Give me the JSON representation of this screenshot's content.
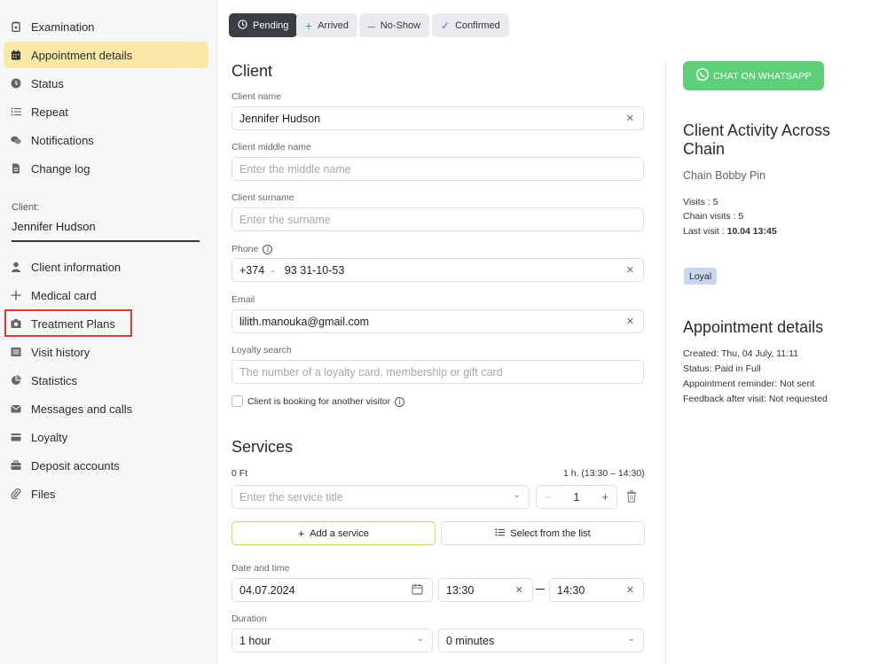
{
  "sidebar": {
    "top_items": [
      {
        "label": "Examination",
        "icon": "clipboard-icon"
      },
      {
        "label": "Appointment details",
        "icon": "calendar-icon"
      },
      {
        "label": "Status",
        "icon": "clock-icon"
      },
      {
        "label": "Repeat",
        "icon": "list-icon"
      },
      {
        "label": "Notifications",
        "icon": "chat-icon"
      },
      {
        "label": "Change log",
        "icon": "document-icon"
      }
    ],
    "client_label": "Client:",
    "client_name": "Jennifer Hudson",
    "client_items": [
      {
        "label": "Client information",
        "icon": "user-icon"
      },
      {
        "label": "Medical card",
        "icon": "plus-icon"
      },
      {
        "label": "Treatment Plans",
        "icon": "camera-icon"
      },
      {
        "label": "Visit history",
        "icon": "list-box-icon"
      },
      {
        "label": "Statistics",
        "icon": "pie-chart-icon"
      },
      {
        "label": "Messages and calls",
        "icon": "envelope-icon"
      },
      {
        "label": "Loyalty",
        "icon": "card-icon"
      },
      {
        "label": "Deposit accounts",
        "icon": "briefcase-icon"
      },
      {
        "label": "Files",
        "icon": "paperclip-icon"
      }
    ]
  },
  "status_chips": [
    {
      "label": "Pending",
      "icon": "clock-icon",
      "active": true
    },
    {
      "label": "Arrived",
      "icon": "plus-icon"
    },
    {
      "label": "No-Show",
      "icon": "minus-icon"
    },
    {
      "label": "Confirmed",
      "icon": "check-icon"
    }
  ],
  "client_section": {
    "title": "Client",
    "name_label": "Client name",
    "name_value": "Jennifer Hudson",
    "middle_label": "Client middle name",
    "middle_placeholder": "Enter the middle name",
    "surname_label": "Client surname",
    "surname_placeholder": "Enter the surname",
    "phone_label": "Phone",
    "phone_code": "+374",
    "phone_number": "93 31-10-53",
    "email_label": "Email",
    "email_value": "lilith.manouka@gmail.com",
    "loyalty_label": "Loyalty search",
    "loyalty_placeholder": "The number of a loyalty card, membership or gift card",
    "another_visitor_label": "Client is booking for another visitor"
  },
  "services_section": {
    "title": "Services",
    "price": "0 Ft",
    "duration_range": "1 h. (13:30 – 14:30)",
    "service_placeholder": "Enter the service title",
    "quantity": "1",
    "add_service_label": "Add a service",
    "select_list_label": "Select from the list",
    "date_time_label": "Date and time",
    "date_value": "04.07.2024",
    "start_time": "13:30",
    "end_time": "14:30",
    "duration_label": "Duration",
    "duration_hours": "1 hour",
    "duration_minutes": "0 minutes"
  },
  "right_panel": {
    "whatsapp_label": "CHAT ON WHATSAPP",
    "activity_title_line1": "Client Activity Across",
    "activity_title_line2": "Chain",
    "chain_name": "Chain Bobby Pin",
    "visits": "Visits : 5",
    "chain_visits": "Chain visits : 5",
    "last_visit_label": "Last visit : ",
    "last_visit_value": "10.04 13:45",
    "badge": "Loyal",
    "details_title": "Appointment details",
    "created": "Created: Thu, 04 July, 11:11",
    "status": "Status: Paid in Full",
    "reminder": "Appointment reminder: Not sent",
    "feedback": "Feedback after visit: Not requested"
  },
  "colors": {
    "active_nav": "#fbe8a6",
    "pending_chip": "#3a3d43",
    "whatsapp": "#5fd07a",
    "highlight": "#e03b2f",
    "loyal_badge": "#c9d6f0"
  }
}
